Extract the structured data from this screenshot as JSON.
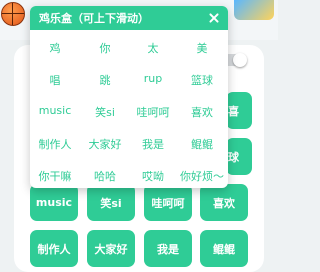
{
  "colors": {
    "accent": "#2fcc96",
    "accent_text": "#ffffff"
  },
  "popup": {
    "title": "鸡乐盒（可上下滑动）",
    "items": [
      "鸡",
      "你",
      "太",
      "美",
      "唱",
      "跳",
      "rup",
      "篮球",
      "music",
      "笑si",
      "哇呵呵",
      "喜欢",
      "制作人",
      "大家好",
      "我是",
      "鲲鲲",
      "你干嘛",
      "哈哈",
      "哎呦",
      "你好烦～"
    ]
  },
  "background": {
    "row_a_edge": "喜",
    "row_b_edge": "球",
    "row1": [
      "music",
      "笑si",
      "哇呵呵",
      "喜欢"
    ],
    "row2": [
      "制作人",
      "大家好",
      "我是",
      "鲲鲲"
    ]
  }
}
